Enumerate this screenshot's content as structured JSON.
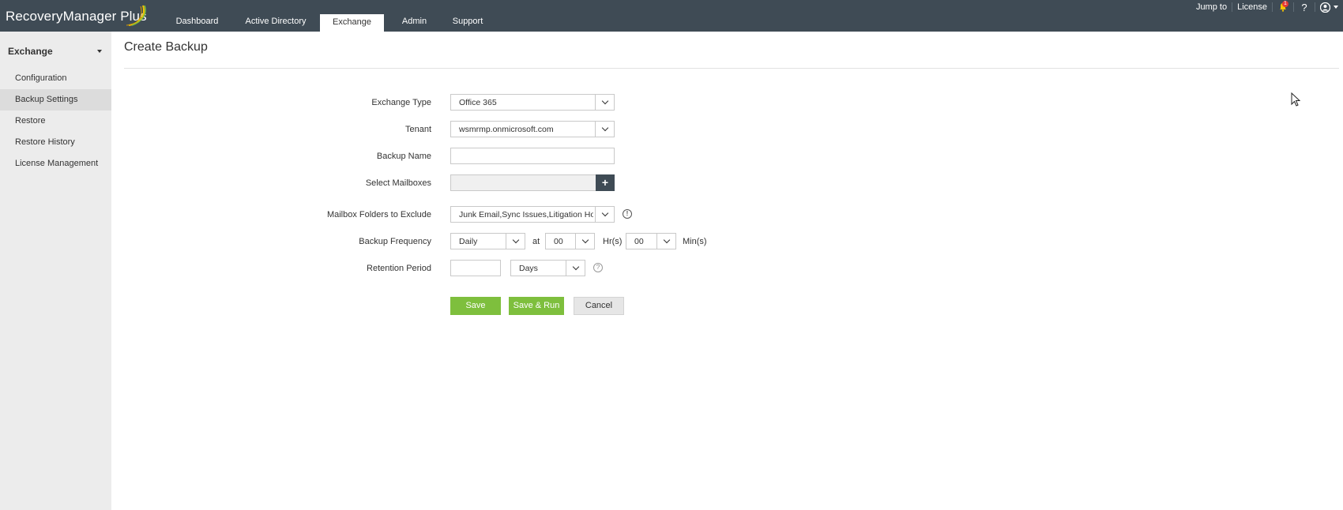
{
  "app": {
    "logo_text": "RecoveryManager",
    "logo_suffix": "Plus"
  },
  "nav": {
    "tabs": [
      {
        "label": "Dashboard"
      },
      {
        "label": "Active Directory"
      },
      {
        "label": "Exchange",
        "active": true
      },
      {
        "label": "Admin"
      },
      {
        "label": "Support"
      }
    ]
  },
  "top_right": {
    "jump_to": "Jump to",
    "license": "License",
    "notification_count": "1",
    "help": "?"
  },
  "sidebar": {
    "heading": "Exchange",
    "items": [
      {
        "label": "Configuration"
      },
      {
        "label": "Backup Settings",
        "active": true
      },
      {
        "label": "Restore"
      },
      {
        "label": "Restore History"
      },
      {
        "label": "License Management"
      }
    ]
  },
  "page": {
    "title": "Create Backup"
  },
  "form": {
    "exchange_type": {
      "label": "Exchange Type",
      "value": "Office 365"
    },
    "tenant": {
      "label": "Tenant",
      "value": "wsmrmp.onmicrosoft.com"
    },
    "backup_name": {
      "label": "Backup Name",
      "value": ""
    },
    "select_mailboxes": {
      "label": "Select Mailboxes",
      "value": "",
      "add_icon": "+"
    },
    "folders_exclude": {
      "label": "Mailbox Folders to Exclude",
      "value": "Junk Email,Sync Issues,Litigation Hold It",
      "info_icon": "!"
    },
    "backup_frequency": {
      "label": "Backup Frequency",
      "value": "Daily",
      "at": "at",
      "hour": "00",
      "hour_unit": "Hr(s)",
      "minute": "00",
      "minute_unit": "Min(s)"
    },
    "retention_period": {
      "label": "Retention Period",
      "value": "",
      "unit": "Days",
      "help_icon": "?"
    }
  },
  "buttons": {
    "save": "Save",
    "save_run": "Save & Run",
    "cancel": "Cancel"
  },
  "colors": {
    "topbar": "#3f4b55",
    "accent_green": "#7ebf3d",
    "sidebar_bg": "#ececec"
  }
}
